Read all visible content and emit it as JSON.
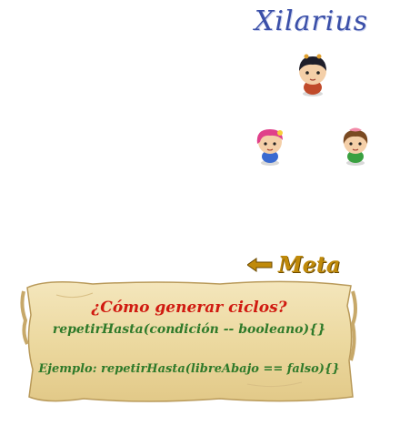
{
  "title": "Xilarius",
  "characters": [
    {
      "id": "boy-dark-hair",
      "hair_color": "#1e1e2a",
      "body_color": "#c04a2a",
      "bow_color": "#e0a030"
    },
    {
      "id": "girl-pink-hair",
      "hair_color": "#e0408a",
      "body_color": "#3a6ad0",
      "bow_color": "#f7d03a"
    },
    {
      "id": "girl-brown-hair",
      "hair_color": "#7a4a22",
      "body_color": "#3aa040",
      "bow_color": "#f28aa8"
    }
  ],
  "goal": {
    "label": "Meta",
    "icon": "arrow-left-icon",
    "color": "#c08a0a"
  },
  "scroll": {
    "heading": "¿Cómo generar ciclos?",
    "syntax": "repetirHasta(condición -- booleano){}",
    "example": "Ejemplo: repetirHasta(libreAbajo == falso){}"
  },
  "colors": {
    "heading": "#d01a10",
    "code": "#2f7a2a",
    "parchment": "#efe0b0",
    "title": "#3a4fa8"
  }
}
